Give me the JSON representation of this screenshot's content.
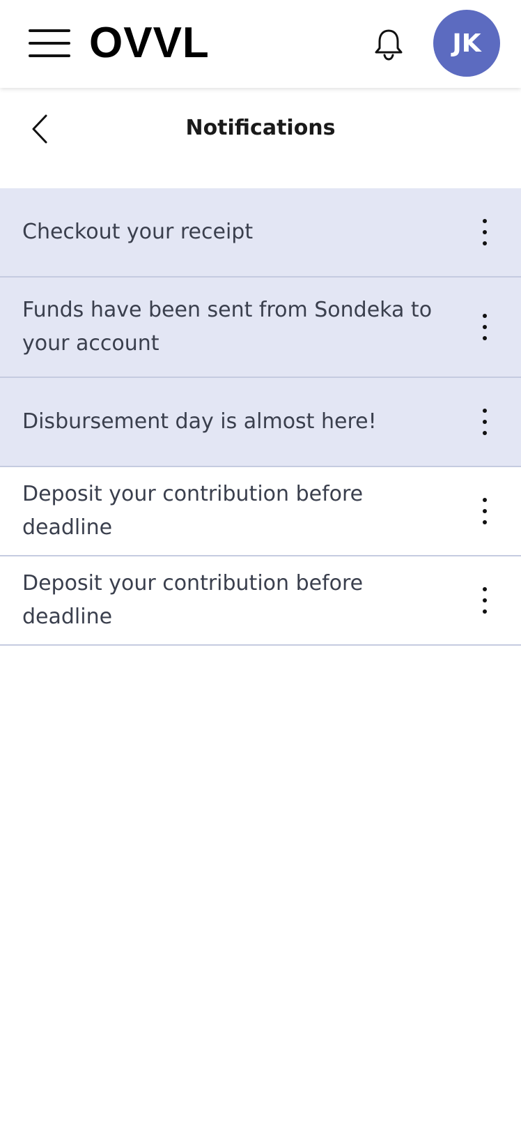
{
  "header": {
    "logo_text": "OVVL",
    "avatar_initials": "JK",
    "menu_icon": "hamburger-icon",
    "bell_icon": "bell-icon"
  },
  "page": {
    "title": "Notifications",
    "back_icon": "chevron-left-icon"
  },
  "notifications": [
    {
      "text": "Checkout your receipt",
      "unread": true
    },
    {
      "text": "Funds have been sent from Sondeka to your account",
      "unread": true
    },
    {
      "text": "Disbursement day is almost here!",
      "unread": true
    },
    {
      "text": "Deposit your contribution before deadline",
      "unread": false
    },
    {
      "text": "Deposit your contribution before deadline",
      "unread": false
    }
  ],
  "colors": {
    "avatar_bg": "#5c6bc0",
    "unread_bg": "#e3e6f4",
    "divider": "#c5cbe0"
  }
}
